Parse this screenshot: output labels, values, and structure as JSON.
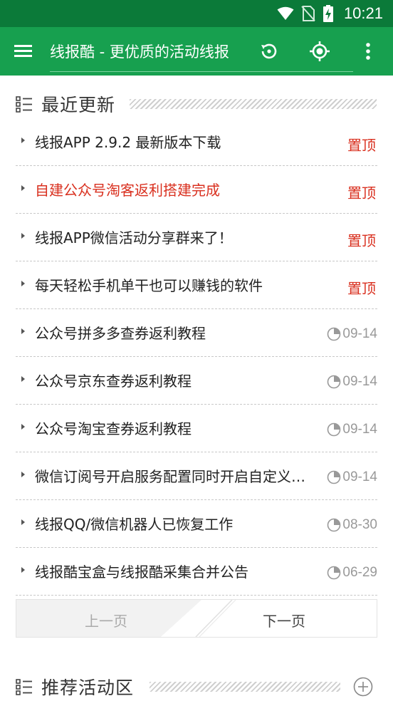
{
  "status_bar": {
    "time": "10:21"
  },
  "app_bar": {
    "title": "线报酷 - 更优质的活动线报"
  },
  "recent": {
    "title": "最近更新",
    "items": [
      {
        "text": "线报APP 2.9.2 最新版本下载",
        "tag": "置顶",
        "highlight": false
      },
      {
        "text": "自建公众号淘客返利搭建完成",
        "tag": "置顶",
        "highlight": true
      },
      {
        "text": "线报APP微信活动分享群来了！",
        "tag": "置顶",
        "highlight": false
      },
      {
        "text": "每天轻松手机单干也可以赚钱的软件",
        "tag": "置顶",
        "highlight": false
      },
      {
        "text": "公众号拼多多查券返利教程",
        "date": "09-14"
      },
      {
        "text": "公众号京东查券返利教程",
        "date": "09-14"
      },
      {
        "text": "公众号淘宝查券返利教程",
        "date": "09-14"
      },
      {
        "text": "微信订阅号开启服务配置同时开启自定义菜单",
        "date": "09-14"
      },
      {
        "text": "线报QQ/微信机器人已恢复工作",
        "date": "08-30"
      },
      {
        "text": "线报酷宝盒与线报酷采集合并公告",
        "date": "06-29"
      }
    ]
  },
  "pager": {
    "prev_label": "上一页",
    "next_label": "下一页"
  },
  "recommend": {
    "title": "推荐活动区"
  },
  "colors": {
    "status_bar": "#0b7a39",
    "app_bar": "#17a04f",
    "pinned": "#d9301f"
  }
}
